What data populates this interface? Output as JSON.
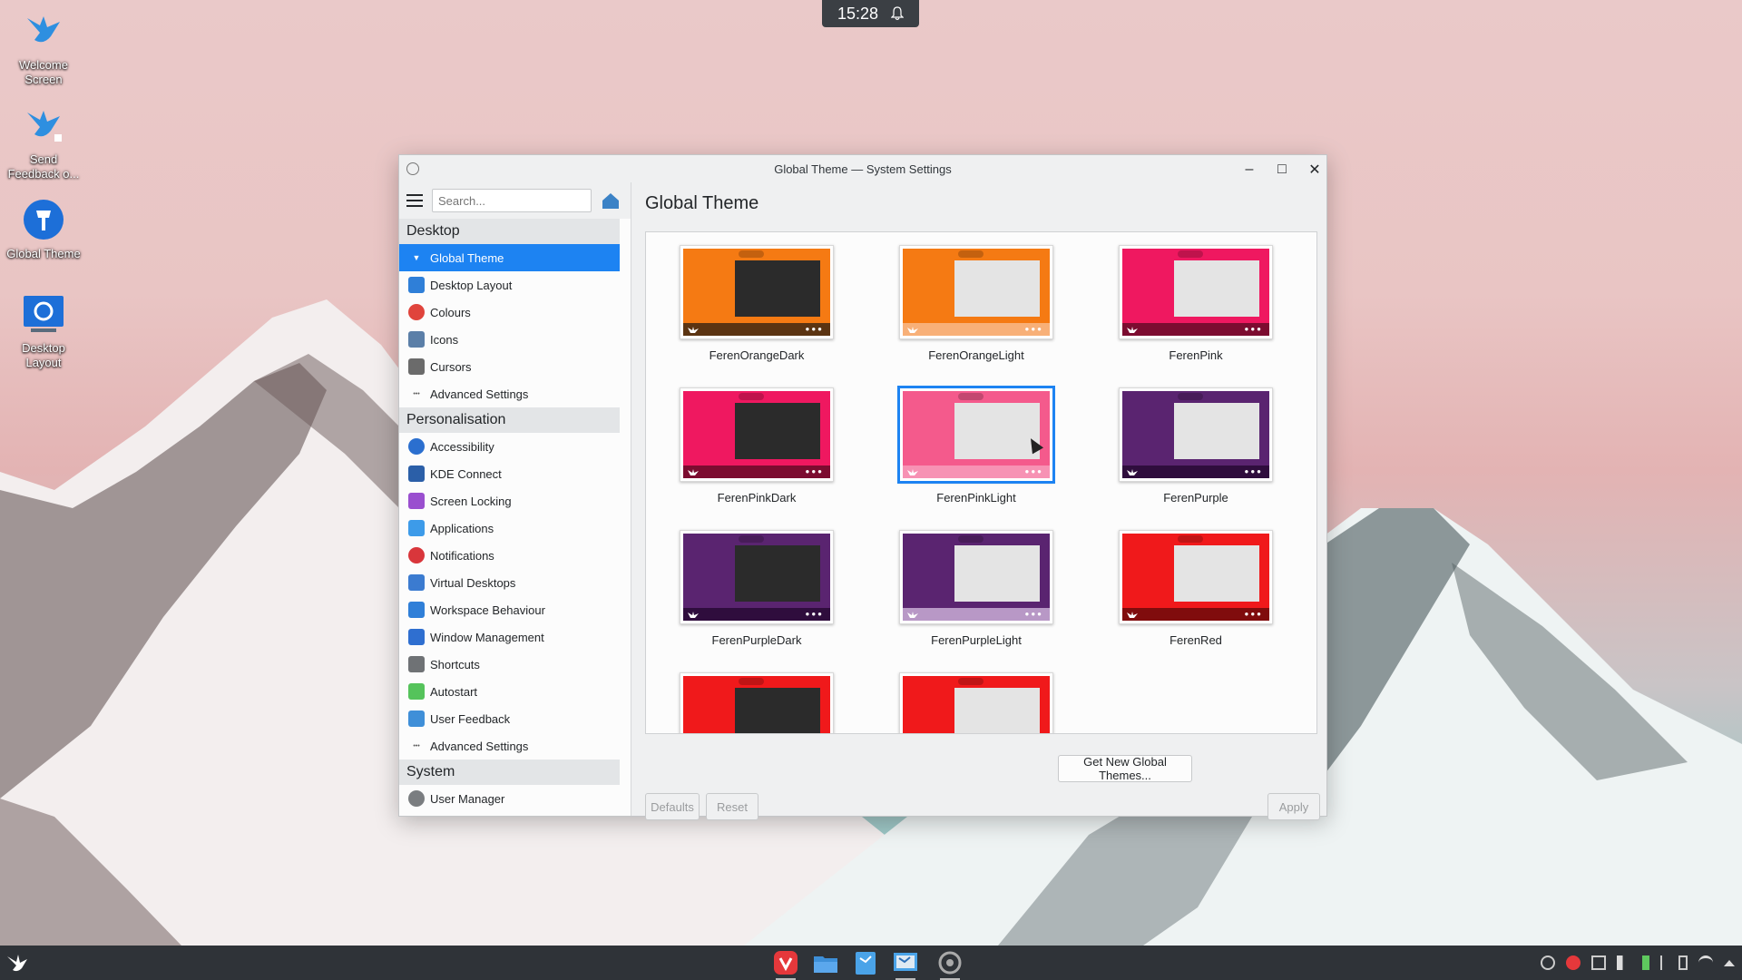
{
  "clock": {
    "time": "15:28"
  },
  "desktop_icons": [
    {
      "label": "Welcome Screen",
      "icon": "feren-bird-icon"
    },
    {
      "label": "Send Feedback o...",
      "icon": "feedback-bird-icon"
    },
    {
      "label": "Global Theme",
      "icon": "global-theme-icon"
    },
    {
      "label": "Desktop Layout",
      "icon": "desktop-layout-icon"
    }
  ],
  "window": {
    "title": "Global Theme — System Settings",
    "search_placeholder": "Search...",
    "page_title": "Global Theme"
  },
  "sidebar": {
    "sections": [
      {
        "label": "Desktop",
        "items": [
          {
            "label": "Global Theme",
            "icon": "global-theme-icon",
            "active": true
          },
          {
            "label": "Desktop Layout",
            "icon": "desktop-layout-icon"
          },
          {
            "label": "Colours",
            "icon": "colours-icon"
          },
          {
            "label": "Icons",
            "icon": "icons-icon"
          },
          {
            "label": "Cursors",
            "icon": "cursor-icon"
          },
          {
            "label": "Advanced Settings",
            "icon": "more-icon"
          }
        ]
      },
      {
        "label": "Personalisation",
        "items": [
          {
            "label": "Accessibility",
            "icon": "accessibility-icon"
          },
          {
            "label": "KDE Connect",
            "icon": "phone-icon"
          },
          {
            "label": "Screen Locking",
            "icon": "lock-icon"
          },
          {
            "label": "Applications",
            "icon": "applications-icon"
          },
          {
            "label": "Notifications",
            "icon": "notifications-icon"
          },
          {
            "label": "Virtual Desktops",
            "icon": "virtual-desktops-icon"
          },
          {
            "label": "Workspace Behaviour",
            "icon": "workspace-icon"
          },
          {
            "label": "Window Management",
            "icon": "window-management-icon"
          },
          {
            "label": "Shortcuts",
            "icon": "keyboard-icon"
          },
          {
            "label": "Autostart",
            "icon": "autostart-icon"
          },
          {
            "label": "User Feedback",
            "icon": "feedback-icon"
          },
          {
            "label": "Advanced Settings",
            "icon": "more-icon"
          }
        ]
      },
      {
        "label": "System",
        "items": [
          {
            "label": "User Manager",
            "icon": "user-icon"
          }
        ]
      }
    ]
  },
  "themes": [
    {
      "name": "FerenOrangeDark",
      "accent": "#f57a13",
      "panel": "#5b3412",
      "window": "#2b2b2b"
    },
    {
      "name": "FerenOrangeLight",
      "accent": "#f57a13",
      "panel": "#f8b078",
      "window": "#e4e4e4"
    },
    {
      "name": "FerenPink",
      "accent": "#ef1860",
      "panel": "#7c0c30",
      "window": "#e4e4e4"
    },
    {
      "name": "FerenPinkDark",
      "accent": "#ef1860",
      "panel": "#7c0c30",
      "window": "#2b2b2b"
    },
    {
      "name": "FerenPinkLight",
      "accent": "#f45a8c",
      "panel": "#f792b4",
      "window": "#e4e4e4",
      "selected": true
    },
    {
      "name": "FerenPurple",
      "accent": "#5a2470",
      "panel": "#2f0d3d",
      "window": "#e4e4e4"
    },
    {
      "name": "FerenPurpleDark",
      "accent": "#5a2470",
      "panel": "#2f0d3d",
      "window": "#2b2b2b"
    },
    {
      "name": "FerenPurpleLight",
      "accent": "#5a2470",
      "panel": "#b898c6",
      "window": "#e4e4e4"
    },
    {
      "name": "FerenRed",
      "accent": "#f0191b",
      "panel": "#800c0d",
      "window": "#e4e4e4"
    },
    {
      "name": "",
      "accent": "#f0191b",
      "panel": "#800c0d",
      "window": "#2b2b2b"
    },
    {
      "name": "",
      "accent": "#f0191b",
      "panel": "#f8a0a0",
      "window": "#e4e4e4"
    }
  ],
  "buttons": {
    "get_new": "Get New Global Themes...",
    "defaults": "Defaults",
    "reset": "Reset",
    "apply": "Apply"
  },
  "colors": {
    "accent": "#1d83f2"
  }
}
